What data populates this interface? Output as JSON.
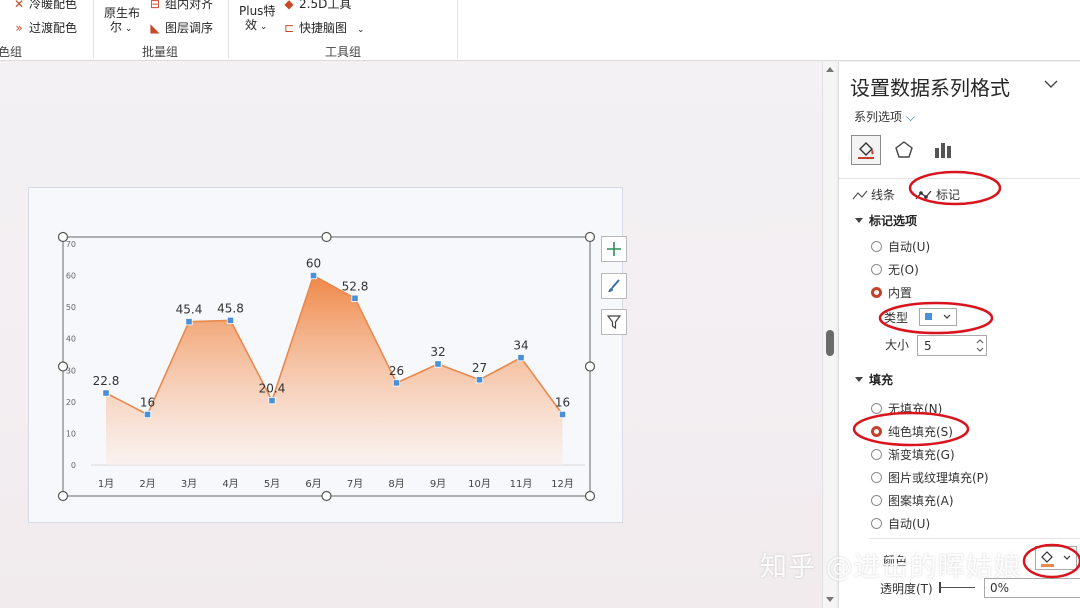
{
  "ribbon": {
    "items": {
      "cold_warm_color": "冷暖配色",
      "transition_color": "过渡配色",
      "native_bool_line1": "原生布",
      "native_bool_line2": "尔",
      "group_align": "组内对齐",
      "layer_order": "图层调序",
      "plus_effect_line1": "Plus特",
      "plus_effect_line2": "效",
      "tool_25d": "2.5D工具",
      "quick_mindmap": "快捷脑图"
    },
    "group_labels": {
      "color_group": "色组",
      "batch_group": "批量组",
      "tools_group": "工具组"
    }
  },
  "chart_data": {
    "type": "area",
    "categories": [
      "1月",
      "2月",
      "3月",
      "4月",
      "5月",
      "6月",
      "7月",
      "8月",
      "9月",
      "10月",
      "11月",
      "12月"
    ],
    "values": [
      22.8,
      16,
      45.4,
      45.8,
      20.4,
      60,
      52.8,
      26,
      32,
      27,
      34,
      16
    ],
    "data_labels": [
      "22.8",
      "16",
      "45.4",
      "45.8",
      "20.4",
      "60",
      "52.8",
      "26",
      "32",
      "27",
      "34",
      "16"
    ],
    "y_ticks": [
      "0",
      "10",
      "20",
      "30",
      "40",
      "50",
      "60",
      "70"
    ],
    "ylim": [
      0,
      70
    ],
    "grid": false,
    "line_color": "#e8894e",
    "fill_top_color": "#ef8746",
    "fill_bottom_color": "#fbeee8",
    "marker_color": "#4a90d9",
    "title": "",
    "xlabel": "",
    "ylabel": ""
  },
  "chart_tools": {
    "add_icon": "plus-icon",
    "style_icon": "brush-icon",
    "filter_icon": "funnel-icon"
  },
  "pane": {
    "title": "设置数据系列格式",
    "series_options": "系列选项",
    "subtabs": {
      "line": "线条",
      "marker": "标记"
    },
    "marker_section": {
      "title": "标记选项",
      "auto": "自动(U)",
      "none": "无(O)",
      "builtin": "内置",
      "type_label": "类型",
      "size_label": "大小",
      "size_value": "5",
      "selected": "builtin"
    },
    "fill_section": {
      "title": "填充",
      "no_fill": "无填充(N)",
      "solid_fill": "纯色填充(S)",
      "gradient_fill": "渐变填充(G)",
      "picture_fill": "图片或纹理填充(P)",
      "pattern_fill": "图案填充(A)",
      "auto": "自动(U)",
      "color_label": "颜色",
      "transparency_label": "透明度(T)",
      "transparency_value": "0%",
      "selected": "solid_fill"
    },
    "accent_color": "#c7402d"
  },
  "watermark": "知乎 @进击的晖姑娘",
  "annotation_color": "#d9141e"
}
